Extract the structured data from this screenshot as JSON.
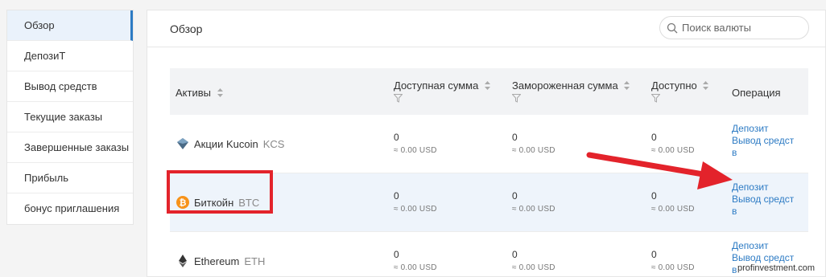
{
  "sidebar": {
    "items": [
      {
        "label": "Обзор"
      },
      {
        "label": "ДепозиТ"
      },
      {
        "label": "Вывод средств"
      },
      {
        "label": "Текущие заказы"
      },
      {
        "label": "Завершенные заказы"
      },
      {
        "label": "Прибыль"
      },
      {
        "label": "бонус приглашения"
      }
    ]
  },
  "main": {
    "title": "Обзор",
    "search_placeholder": "Поиск валюты"
  },
  "table": {
    "columns": [
      "Активы",
      "Доступная сумма",
      "Замороженная сумма",
      "Доступно",
      "Операция"
    ],
    "rows": [
      {
        "name": "Акции Kucoin",
        "symbol": "KCS",
        "icon": "kucoin-icon",
        "available": "0",
        "available_usd": "≈ 0.00 USD",
        "frozen": "0",
        "frozen_usd": "≈ 0.00 USD",
        "free": "0",
        "free_usd": "≈ 0.00 USD",
        "deposit": "Депозит",
        "withdraw_1": "Вывод средст",
        "withdraw_2": "в"
      },
      {
        "name": "Биткойн",
        "symbol": "BTC",
        "icon": "bitcoin-icon",
        "available": "0",
        "available_usd": "≈ 0.00 USD",
        "frozen": "0",
        "frozen_usd": "≈ 0.00 USD",
        "free": "0",
        "free_usd": "≈ 0.00 USD",
        "deposit": "Депозит",
        "withdraw_1": "Вывод средст",
        "withdraw_2": "в"
      },
      {
        "name": "Ethereum",
        "symbol": "ETH",
        "icon": "ethereum-icon",
        "available": "0",
        "available_usd": "≈ 0.00 USD",
        "frozen": "0",
        "frozen_usd": "≈ 0.00 USD",
        "free": "0",
        "free_usd": "≈ 0.00 USD",
        "deposit": "Депозит",
        "withdraw_1": "Вывод средст",
        "withdraw_2": "в"
      }
    ]
  },
  "watermark": "profinvestment.com",
  "colors": {
    "accent": "#2d7bc4",
    "annotation": "#e3232b",
    "bitcoin": "#f7931a"
  }
}
